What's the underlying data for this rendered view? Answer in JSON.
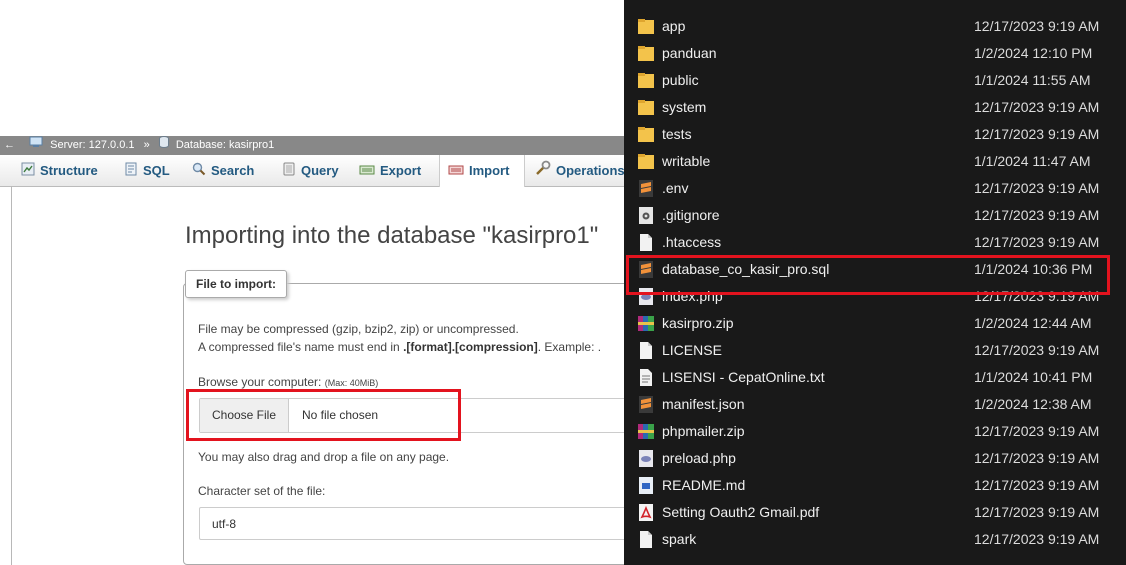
{
  "pma": {
    "breadcrumb": {
      "server_label": "Server: 127.0.0.1",
      "separator": "»",
      "database_label": "Database: kasirpro1"
    },
    "tabs": [
      {
        "label": "Structure",
        "icon": "structure-icon"
      },
      {
        "label": "SQL",
        "icon": "sql-icon"
      },
      {
        "label": "Search",
        "icon": "search-icon"
      },
      {
        "label": "Query",
        "icon": "query-icon"
      },
      {
        "label": "Export",
        "icon": "export-icon"
      },
      {
        "label": "Import",
        "icon": "import-icon",
        "active": true
      },
      {
        "label": "Operations",
        "icon": "operations-icon"
      }
    ],
    "title": "Importing into the database \"kasirpro1\"",
    "legend": "File to import:",
    "compress_line1": "File may be compressed (gzip, bzip2, zip) or uncompressed.",
    "compress_line2_prefix": "A compressed file's name must end in ",
    "compress_line2_format": ".[format].[compression]",
    "compress_line2_suffix": ". Example: .",
    "browse_label": "Browse your computer:",
    "max_size": "(Max: 40MiB)",
    "choose_file_button": "Choose File",
    "no_file_text": "No file chosen",
    "drag_drop_text": "You may also drag and drop a file on any page.",
    "charset_label": "Character set of the file:",
    "charset_value": "utf-8",
    "highlight_color": "#e3131e"
  },
  "explorer": {
    "files": [
      {
        "name": "app",
        "date": "12/17/2023 9:19 AM",
        "icon": "folder-icon"
      },
      {
        "name": "panduan",
        "date": "1/2/2024 12:10 PM",
        "icon": "folder-icon"
      },
      {
        "name": "public",
        "date": "1/1/2024 11:55 AM",
        "icon": "folder-icon"
      },
      {
        "name": "system",
        "date": "12/17/2023 9:19 AM",
        "icon": "folder-icon"
      },
      {
        "name": "tests",
        "date": "12/17/2023 9:19 AM",
        "icon": "folder-icon"
      },
      {
        "name": "writable",
        "date": "1/1/2024 11:47 AM",
        "icon": "folder-icon"
      },
      {
        "name": ".env",
        "date": "12/17/2023 9:19 AM",
        "icon": "sublime-file-icon"
      },
      {
        "name": ".gitignore",
        "date": "12/17/2023 9:19 AM",
        "icon": "settings-file-icon"
      },
      {
        "name": ".htaccess",
        "date": "12/17/2023 9:19 AM",
        "icon": "blank-file-icon"
      },
      {
        "name": "database_co_kasir_pro.sql",
        "date": "1/1/2024 10:36 PM",
        "icon": "sublime-file-icon",
        "highlighted": true
      },
      {
        "name": "index.php",
        "date": "12/17/2023 9:19 AM",
        "icon": "php-file-icon"
      },
      {
        "name": "kasirpro.zip",
        "date": "1/2/2024 12:44 AM",
        "icon": "winrar-archive-icon"
      },
      {
        "name": "LICENSE",
        "date": "12/17/2023 9:19 AM",
        "icon": "blank-file-icon"
      },
      {
        "name": "LISENSI - CepatOnline.txt",
        "date": "1/1/2024 10:41 PM",
        "icon": "text-file-icon"
      },
      {
        "name": "manifest.json",
        "date": "1/2/2024 12:38 AM",
        "icon": "sublime-file-icon"
      },
      {
        "name": "phpmailer.zip",
        "date": "12/17/2023 9:19 AM",
        "icon": "winrar-archive-icon"
      },
      {
        "name": "preload.php",
        "date": "12/17/2023 9:19 AM",
        "icon": "php-file-icon"
      },
      {
        "name": "README.md",
        "date": "12/17/2023 9:19 AM",
        "icon": "markdown-file-icon"
      },
      {
        "name": "Setting Oauth2 Gmail.pdf",
        "date": "12/17/2023 9:19 AM",
        "icon": "pdf-file-icon"
      },
      {
        "name": "spark",
        "date": "12/17/2023 9:19 AM",
        "icon": "blank-file-icon"
      }
    ]
  }
}
